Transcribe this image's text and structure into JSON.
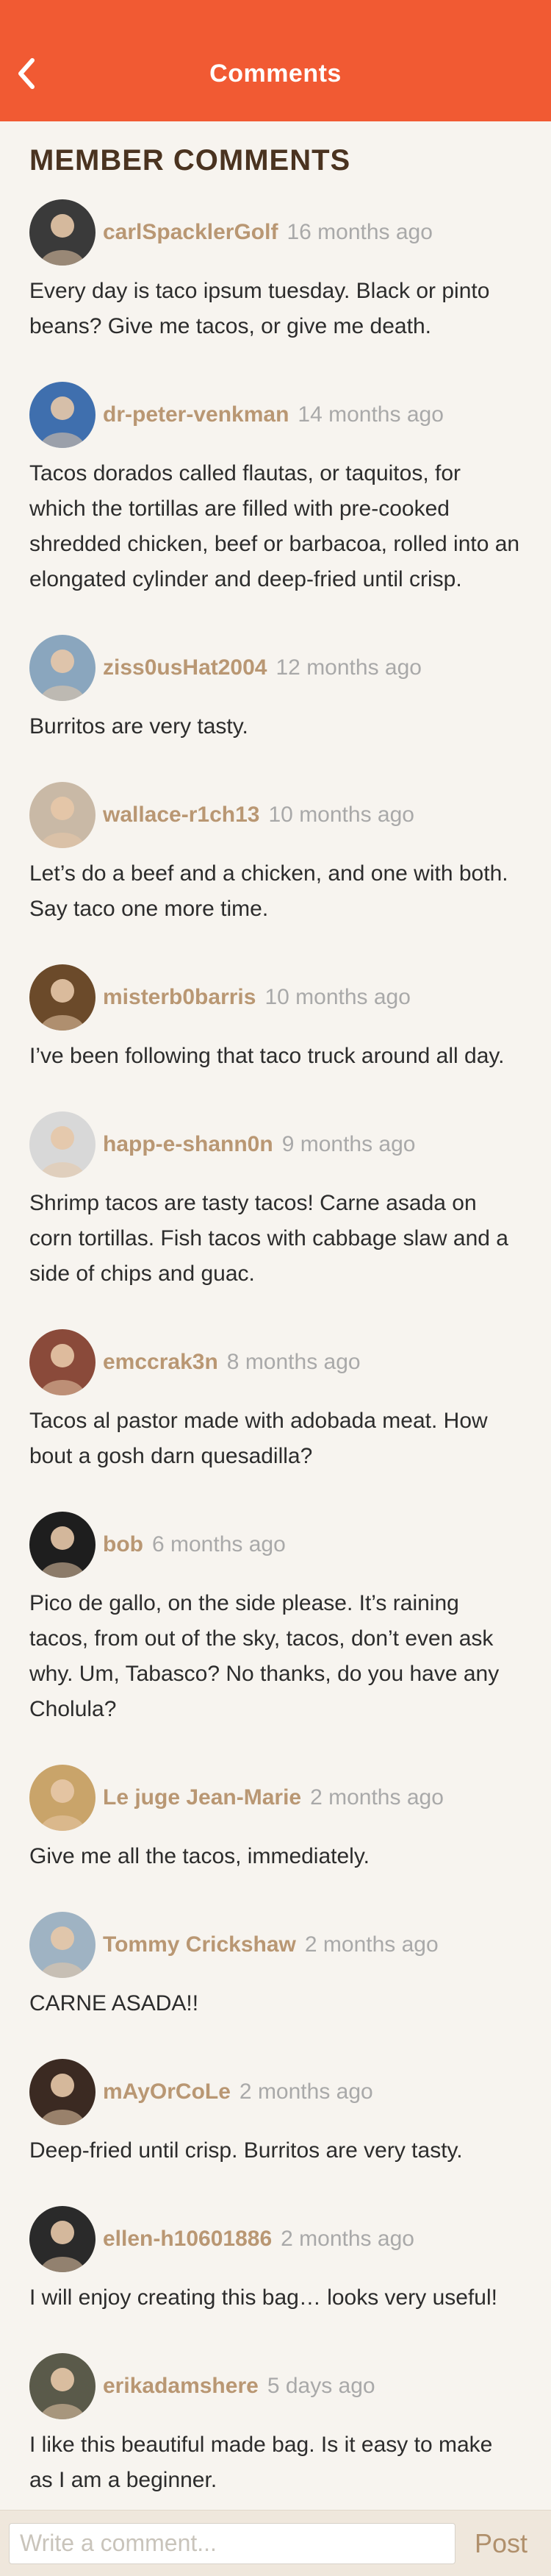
{
  "header": {
    "title": "Comments",
    "back_icon": "chevron-left-icon"
  },
  "section_title": "MEMBER COMMENTS",
  "comments": [
    {
      "username": "carlSpacklerGolf",
      "time": "16 months ago",
      "text": "Every day is taco ipsum tuesday. Black or pinto beans? Give me tacos, or give me death.",
      "avatar_color": "#3a3a3a"
    },
    {
      "username": "dr-peter-venkman",
      "time": "14 months ago",
      "text": "Tacos dorados called flautas, or taquitos, for which the tortillas are filled with pre-cooked shredded chicken, beef or barbacoa, rolled into an elongated cylinder and deep-fried until crisp.",
      "avatar_color": "#3f6fae"
    },
    {
      "username": "ziss0usHat2004",
      "time": "12 months ago",
      "text": "Burritos are very tasty.",
      "avatar_color": "#8aa6be"
    },
    {
      "username": "wallace-r1ch13",
      "time": "10 months ago",
      "text": "Let’s do a beef and a chicken, and one with both. Say taco one more time.",
      "avatar_color": "#c9b9a6"
    },
    {
      "username": "misterb0barris",
      "time": "10 months ago",
      "text": "I’ve been following that taco truck around all day.",
      "avatar_color": "#6b4a2a"
    },
    {
      "username": "happ-e-shann0n",
      "time": "9 months ago",
      "text": "Shrimp tacos are tasty tacos! Carne asada on corn tortillas. Fish tacos with cabbage slaw and a side of chips and guac.",
      "avatar_color": "#d8d8d8"
    },
    {
      "username": "emccrak3n",
      "time": "8 months ago",
      "text": "Tacos al pastor made with adobada meat. How bout a gosh darn quesadilla?",
      "avatar_color": "#8a4a3a"
    },
    {
      "username": "bob",
      "time": "6 months ago",
      "text": "Pico de gallo, on the side please. It’s raining tacos, from out of the sky, tacos, don’t even ask why. Um, Tabasco? No thanks, do you have any Cholula?",
      "avatar_color": "#1e1e1e"
    },
    {
      "username": "Le juge Jean-Marie",
      "time": "2 months ago",
      "text": "Give me all the tacos, immediately.",
      "avatar_color": "#c9a46a"
    },
    {
      "username": "Tommy Crickshaw",
      "time": "2 months ago",
      "text": "CARNE ASADA!!",
      "avatar_color": "#9fb3c3"
    },
    {
      "username": "mAyOrCoLe",
      "time": "2 months ago",
      "text": "Deep-fried until crisp. Burritos are very tasty.",
      "avatar_color": "#3b2a22"
    },
    {
      "username": "ellen-h10601886",
      "time": "2 months ago",
      "text": "I will enjoy creating this bag… looks very useful!",
      "avatar_color": "#2a2a2a"
    },
    {
      "username": "erikadamshere",
      "time": "5 days ago",
      "text": "I like this beautiful made bag. Is it easy to make as I am a beginner.",
      "avatar_color": "#5a5a4a"
    }
  ],
  "footer": {
    "placeholder": "Write a comment...",
    "post_label": "Post"
  }
}
